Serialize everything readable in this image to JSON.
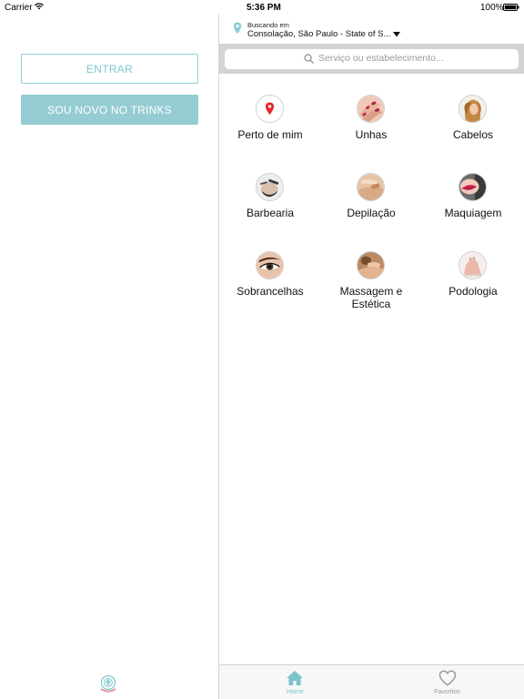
{
  "status_bar": {
    "carrier": "Carrier",
    "time": "5:36 PM",
    "battery": "100%"
  },
  "left_pane": {
    "login_label": "ENTRAR",
    "signup_label": "SOU NOVO NO TRINKS"
  },
  "location": {
    "label": "Buscando em",
    "value": "Consolação, São Paulo - State of S..."
  },
  "search": {
    "placeholder": "Serviço ou estabelecimento..."
  },
  "categories": [
    {
      "label": "Perto de mim",
      "icon": "location-pin-icon"
    },
    {
      "label": "Unhas",
      "icon": "nails-photo"
    },
    {
      "label": "Cabelos",
      "icon": "hair-photo"
    },
    {
      "label": "Barbearia",
      "icon": "barber-photo"
    },
    {
      "label": "Depilação",
      "icon": "waxing-photo"
    },
    {
      "label": "Maquiagem",
      "icon": "makeup-photo"
    },
    {
      "label": "Sobrancelhas",
      "icon": "eyebrow-photo"
    },
    {
      "label": "Massagem e Estética",
      "icon": "massage-photo"
    },
    {
      "label": "Podologia",
      "icon": "foot-photo"
    }
  ],
  "tabs": [
    {
      "label": "Home",
      "icon": "home-icon",
      "active": true
    },
    {
      "label": "Favoritos",
      "icon": "heart-icon",
      "active": false
    }
  ],
  "colors": {
    "accent": "#95ccd3",
    "pin_red": "#e8262c",
    "tab_active": "#7cc3cc",
    "tab_inactive": "#9b9b9b"
  }
}
